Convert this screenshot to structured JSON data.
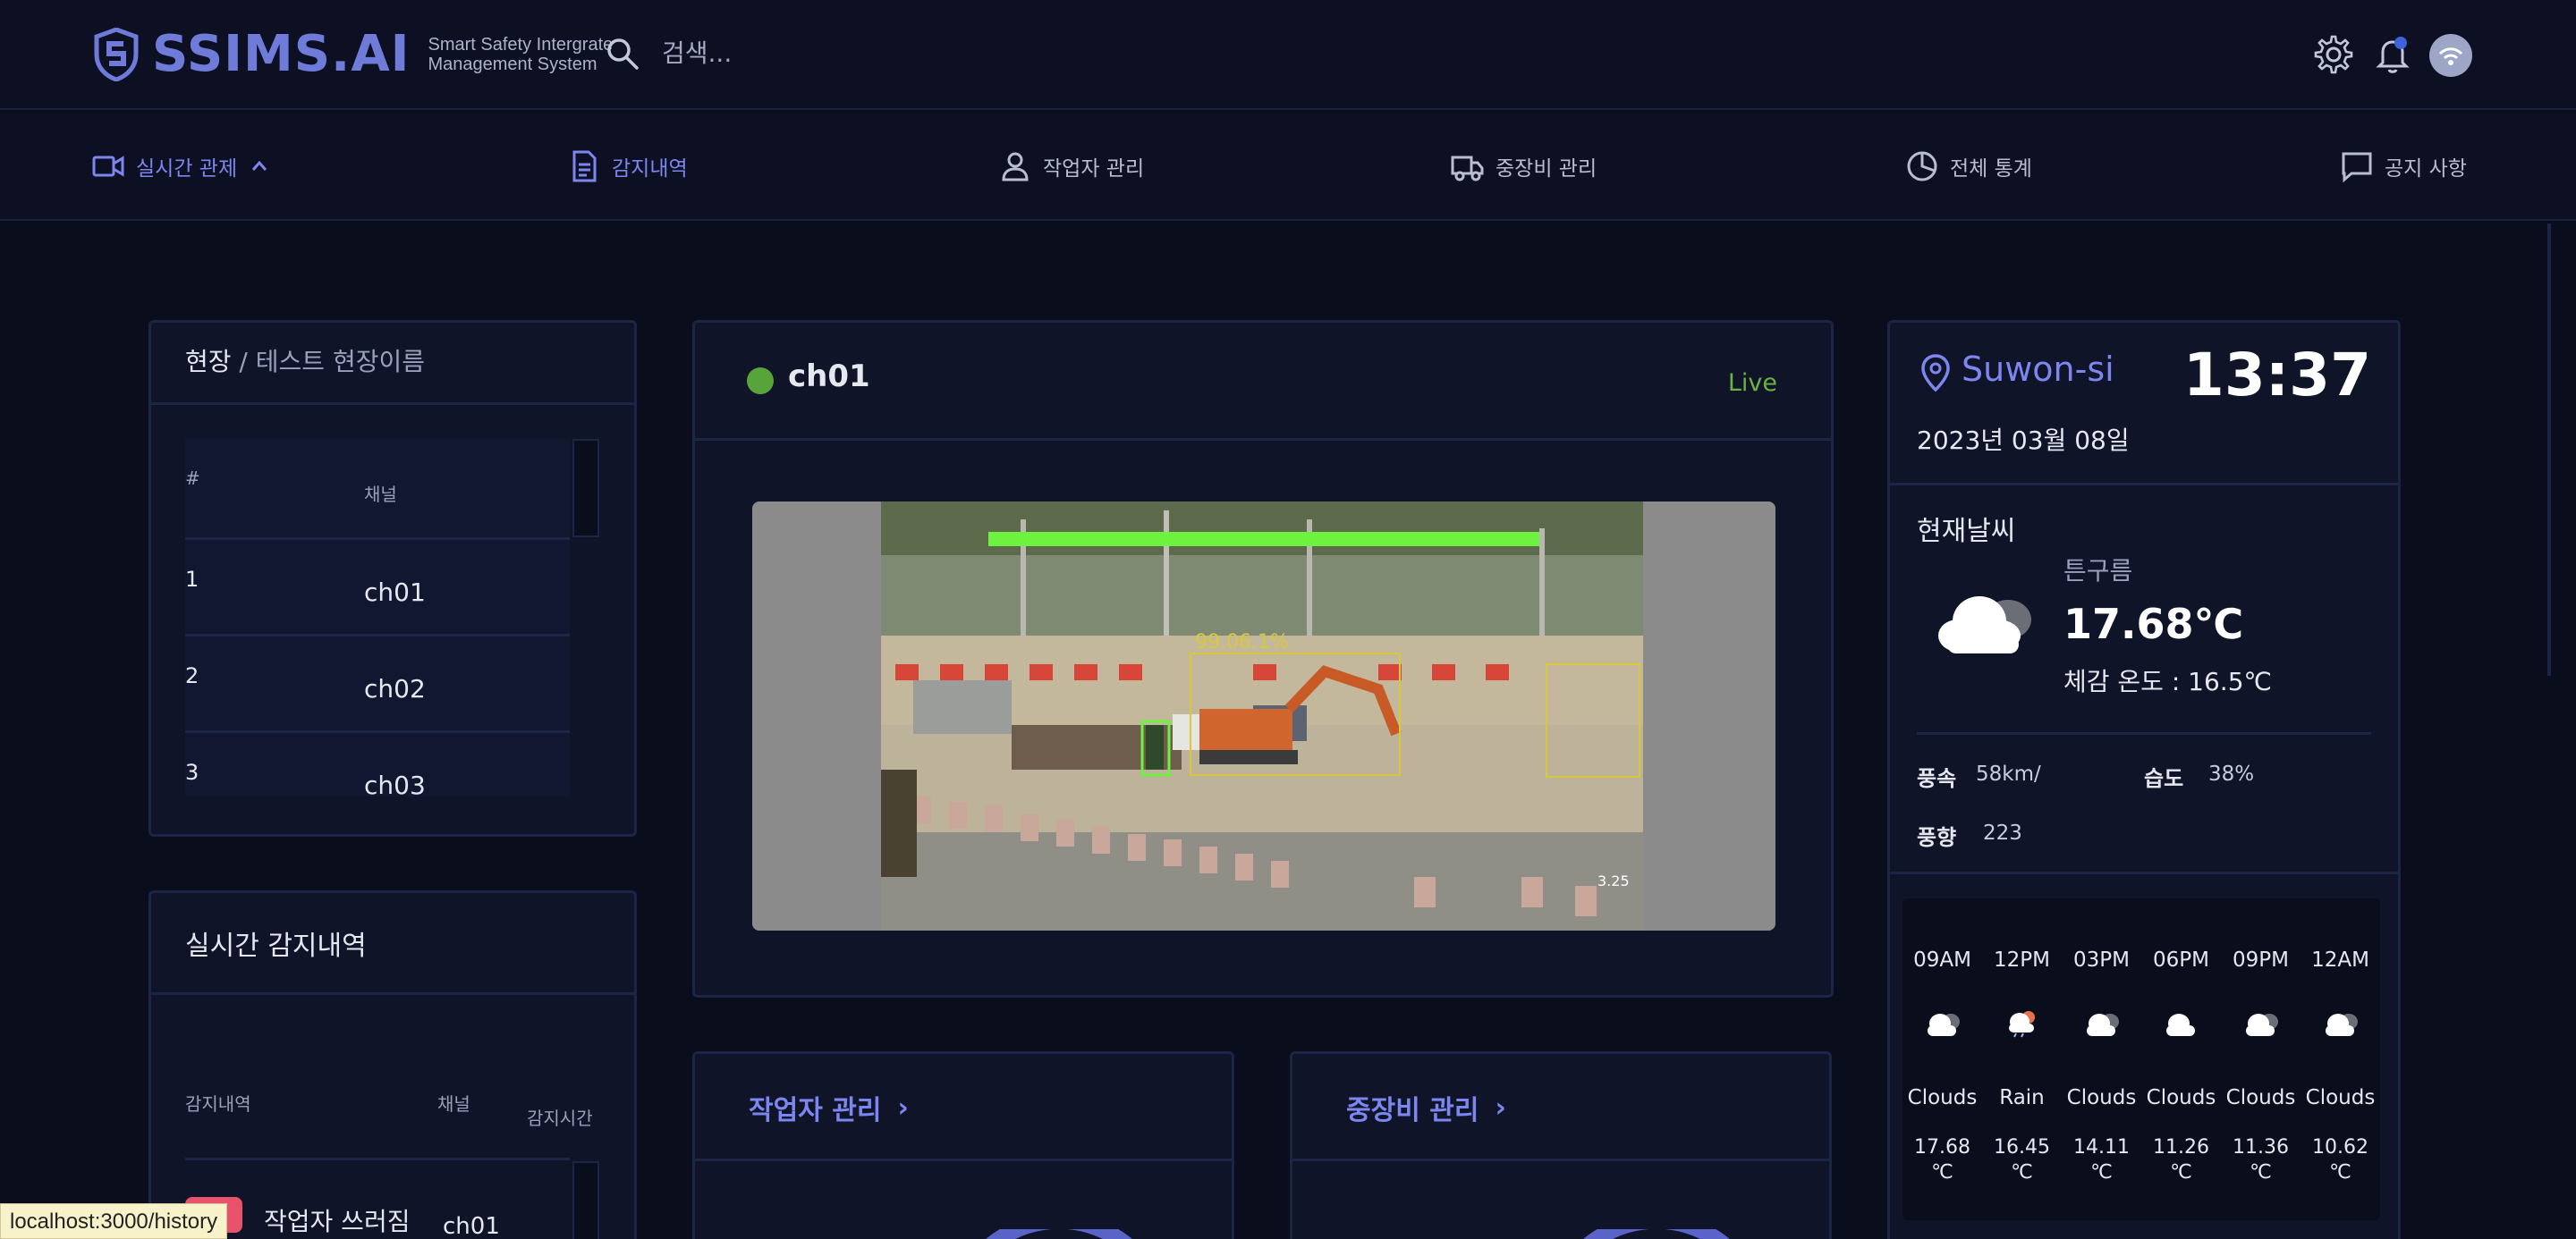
{
  "header": {
    "logo_text": "SSIMS.AI",
    "logo_sub_1": "Smart Safety Intergrate",
    "logo_sub_2": "Management System",
    "search_placeholder": "검색...",
    "icons": [
      "gear-icon",
      "bell-icon",
      "avatar"
    ]
  },
  "nav": {
    "items": [
      {
        "label": "실시간 관제",
        "icon": "video-camera-icon",
        "active": true
      },
      {
        "label": "감지내역",
        "icon": "document-icon",
        "active": true
      },
      {
        "label": "작업자 관리",
        "icon": "person-icon",
        "active": false
      },
      {
        "label": "중장비 관리",
        "icon": "truck-icon",
        "active": false
      },
      {
        "label": "전체 통계",
        "icon": "pie-chart-icon",
        "active": false
      },
      {
        "label": "공지 사항",
        "icon": "chat-icon",
        "active": false
      }
    ]
  },
  "site": {
    "label": "현장",
    "separator": " / ",
    "name": "테스트 현장이름",
    "table_headers": {
      "num": "#",
      "channel": "채널"
    },
    "channels": [
      {
        "num": "1",
        "name": "ch01"
      },
      {
        "num": "2",
        "name": "ch02"
      },
      {
        "num": "3",
        "name": "ch03"
      }
    ]
  },
  "detections": {
    "title": "실시간 감지내역",
    "headers": {
      "event": "감지내역",
      "channel": "채널",
      "time": "감지시간"
    },
    "rows": [
      {
        "event": "작업자 쓰러짐",
        "channel": "ch01"
      }
    ]
  },
  "video": {
    "channel": "ch01",
    "status": "Live",
    "overlay_text": "99.06.1%",
    "timestamp": "3.25"
  },
  "weather": {
    "city": "Suwon-si",
    "time": "13:37",
    "date": "2023년 03월 08일",
    "current_label": "현재날씨",
    "description": "튼구름",
    "temperature": "17.68℃",
    "feels_like": "체감 온도 : 16.5℃",
    "wind_speed_label": "풍속",
    "wind_speed": "58km/",
    "humidity_label": "습도",
    "humidity": "38%",
    "wind_dir_label": "풍향",
    "wind_dir": "223",
    "forecast": [
      {
        "time": "09AM",
        "main": "Clouds",
        "temp": "17.68",
        "unit": "℃",
        "icon": "cloud-icon"
      },
      {
        "time": "12PM",
        "main": "Rain",
        "temp": "16.45",
        "unit": "℃",
        "icon": "rain-icon"
      },
      {
        "time": "03PM",
        "main": "Clouds",
        "temp": "14.11",
        "unit": "℃",
        "icon": "cloud-icon"
      },
      {
        "time": "06PM",
        "main": "Clouds",
        "temp": "11.26",
        "unit": "℃",
        "icon": "cloud-icon"
      },
      {
        "time": "09PM",
        "main": "Clouds",
        "temp": "11.36",
        "unit": "℃",
        "icon": "cloud-icon"
      },
      {
        "time": "12AM",
        "main": "Clouds",
        "temp": "10.62",
        "unit": "℃",
        "icon": "cloud-icon"
      }
    ]
  },
  "cards": {
    "workers_title": "작업자 관리",
    "equipment_title": "중장비 관리"
  },
  "statusbar": {
    "url": "localhost:3000/history"
  },
  "colors": {
    "accent": "#7c86ef",
    "live": "#58a33a",
    "background": "#0a0d1c",
    "panel": "#0f1428"
  }
}
